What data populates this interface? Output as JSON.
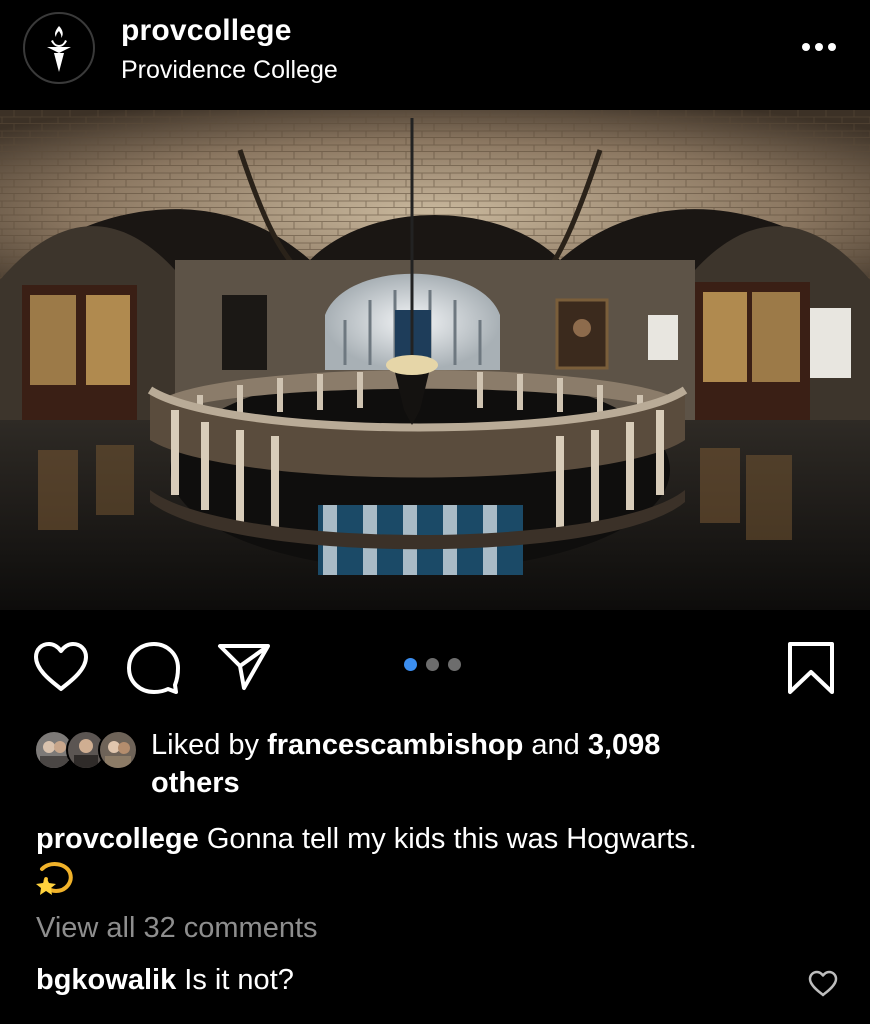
{
  "post": {
    "username": "provcollege",
    "location": "Providence College",
    "likes_prefix": "Liked by ",
    "liked_by_user": "francescambishop",
    "likes_and": " and ",
    "likes_count": "3,098",
    "likes_suffix": " others",
    "caption_user": "provcollege",
    "caption_text": " Gonna tell my kids this was Hogwarts.",
    "caption_emoji": "dizzy-star-emoji",
    "view_comments": "View all 32 comments",
    "comment": {
      "user": "bgkowalik",
      "text": " Is it not?"
    },
    "carousel": {
      "count": 3,
      "active_index": 0
    },
    "photo": "Gothic vaulted rotunda interior with balustrade, chandelier and stained glass window"
  },
  "icons": {
    "avatar": "providence-torch-logo",
    "more": "more-options-icon",
    "like": "heart-icon",
    "comment": "comment-bubble-icon",
    "share": "paper-plane-icon",
    "save": "bookmark-icon"
  },
  "colors": {
    "background": "#000000",
    "text": "#ffffff",
    "muted": "#8e8e8e",
    "carousel_active": "#3b8ef0",
    "carousel_inactive": "#6d6d6d"
  }
}
